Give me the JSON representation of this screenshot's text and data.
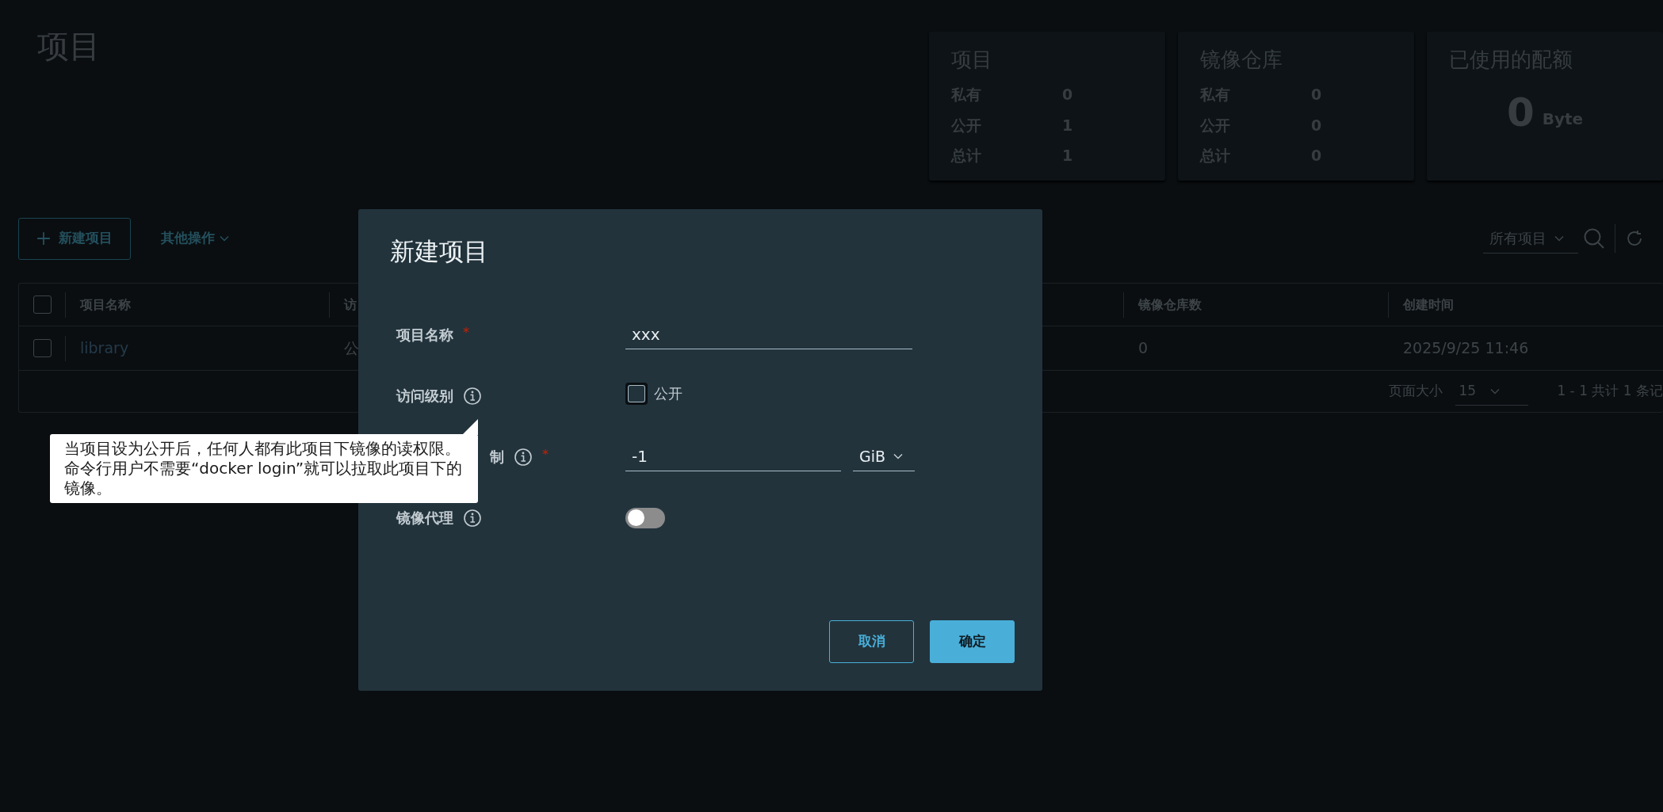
{
  "page_title": "项目",
  "summary_cards": [
    {
      "kind": "counts",
      "title": "项目",
      "rows": [
        {
          "label": "私有",
          "value": "0"
        },
        {
          "label": "公开",
          "value": "1"
        },
        {
          "label": "总计",
          "value": "1"
        }
      ]
    },
    {
      "kind": "counts",
      "title": "镜像仓库",
      "rows": [
        {
          "label": "私有",
          "value": "0"
        },
        {
          "label": "公开",
          "value": "0"
        },
        {
          "label": "总计",
          "value": "0"
        }
      ]
    },
    {
      "kind": "quota",
      "title": "已使用的配额",
      "value": "0",
      "unit": "Byte"
    }
  ],
  "toolbar": {
    "new_button": "新建项目",
    "actions_menu": "其他操作",
    "filter": "所有项目"
  },
  "table": {
    "header_checked": false,
    "columns": [
      "项目名称",
      "访",
      "镜像仓库数",
      "创建时间"
    ],
    "rows": [
      {
        "selected": false,
        "cells": [
          "library",
          "公",
          "0",
          "2025/9/25 11:46"
        ]
      }
    ]
  },
  "pagination": {
    "page_size_label": "页面大小",
    "page_size": "15",
    "summary": "1 - 1 共计 1 条记"
  },
  "dialog": {
    "title": "新建项目",
    "fields": [
      {
        "kind": "text",
        "label": "项目名称",
        "required_mark": "*",
        "info": false,
        "value": "xxx"
      },
      {
        "kind": "checkbox",
        "label": "访问级别",
        "info": true,
        "option": "公开",
        "checked": false
      },
      {
        "kind": "quota",
        "label": "制",
        "required_mark": "*",
        "info": true,
        "value": "-1",
        "unit": "GiB"
      },
      {
        "kind": "toggle",
        "label": "镜像代理",
        "info": true,
        "on": false
      }
    ],
    "buttons": [
      {
        "kind": "secondary",
        "label": "取消"
      },
      {
        "kind": "primary",
        "label": "确定"
      }
    ]
  },
  "tooltip": {
    "text": "当项目设为公开后，任何人都有此项目下镜像的读权限。命令行用户不需要“docker login”就可以拉取此项目下的镜像。"
  }
}
